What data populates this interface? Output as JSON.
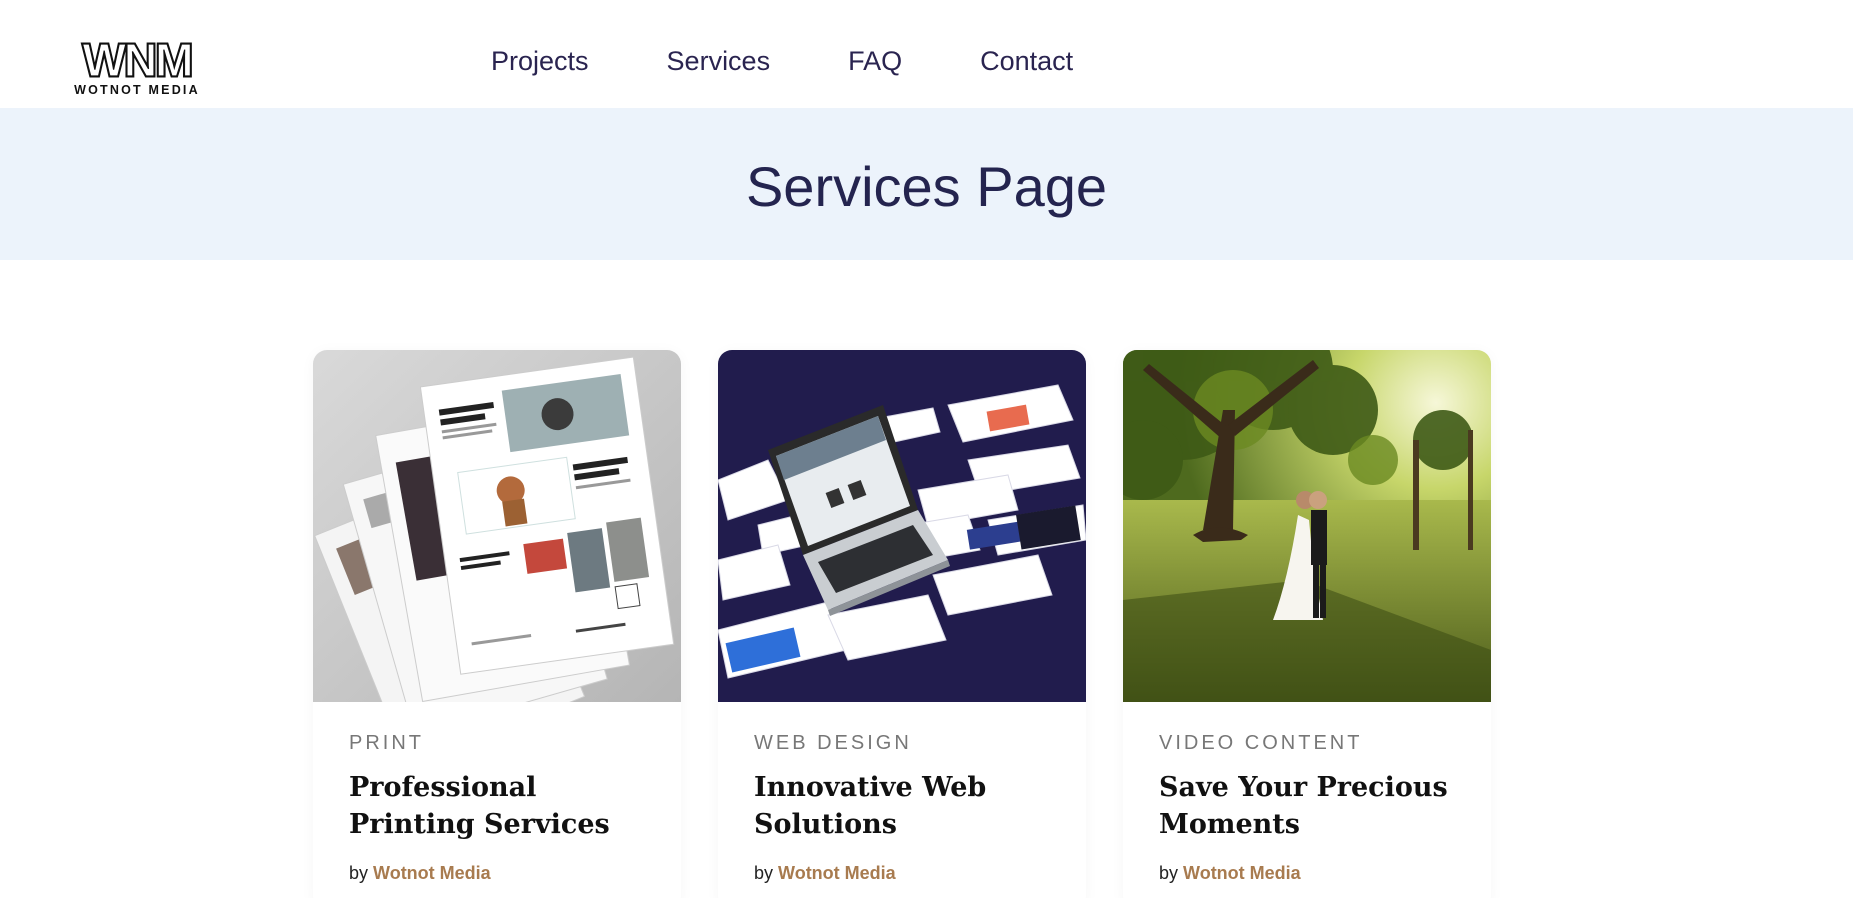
{
  "header": {
    "logo": {
      "main": "WNM",
      "sub": "WOTNOT MEDIA"
    },
    "nav": [
      {
        "label": "Projects"
      },
      {
        "label": "Services"
      },
      {
        "label": "FAQ"
      },
      {
        "label": "Contact"
      }
    ]
  },
  "banner": {
    "title": "Services Page"
  },
  "cards": [
    {
      "category": "PRINT",
      "title": "Professional Printing Services",
      "by": "by",
      "author": "Wotnot Media",
      "image": "print-flyers-image"
    },
    {
      "category": "WEB DESIGN",
      "title": "Innovative Web Solutions",
      "by": "by",
      "author": "Wotnot Media",
      "image": "laptop-websites-image"
    },
    {
      "category": "VIDEO CONTENT",
      "title": "Save Your Precious Moments",
      "by": "by",
      "author": "Wotnot Media",
      "image": "wedding-couple-image"
    }
  ],
  "colors": {
    "nav_text": "#2a2450",
    "banner_bg": "#ecf3fb",
    "banner_title": "#24244f",
    "author_link": "#a87b4f",
    "web_card_bg": "#211c4d"
  }
}
